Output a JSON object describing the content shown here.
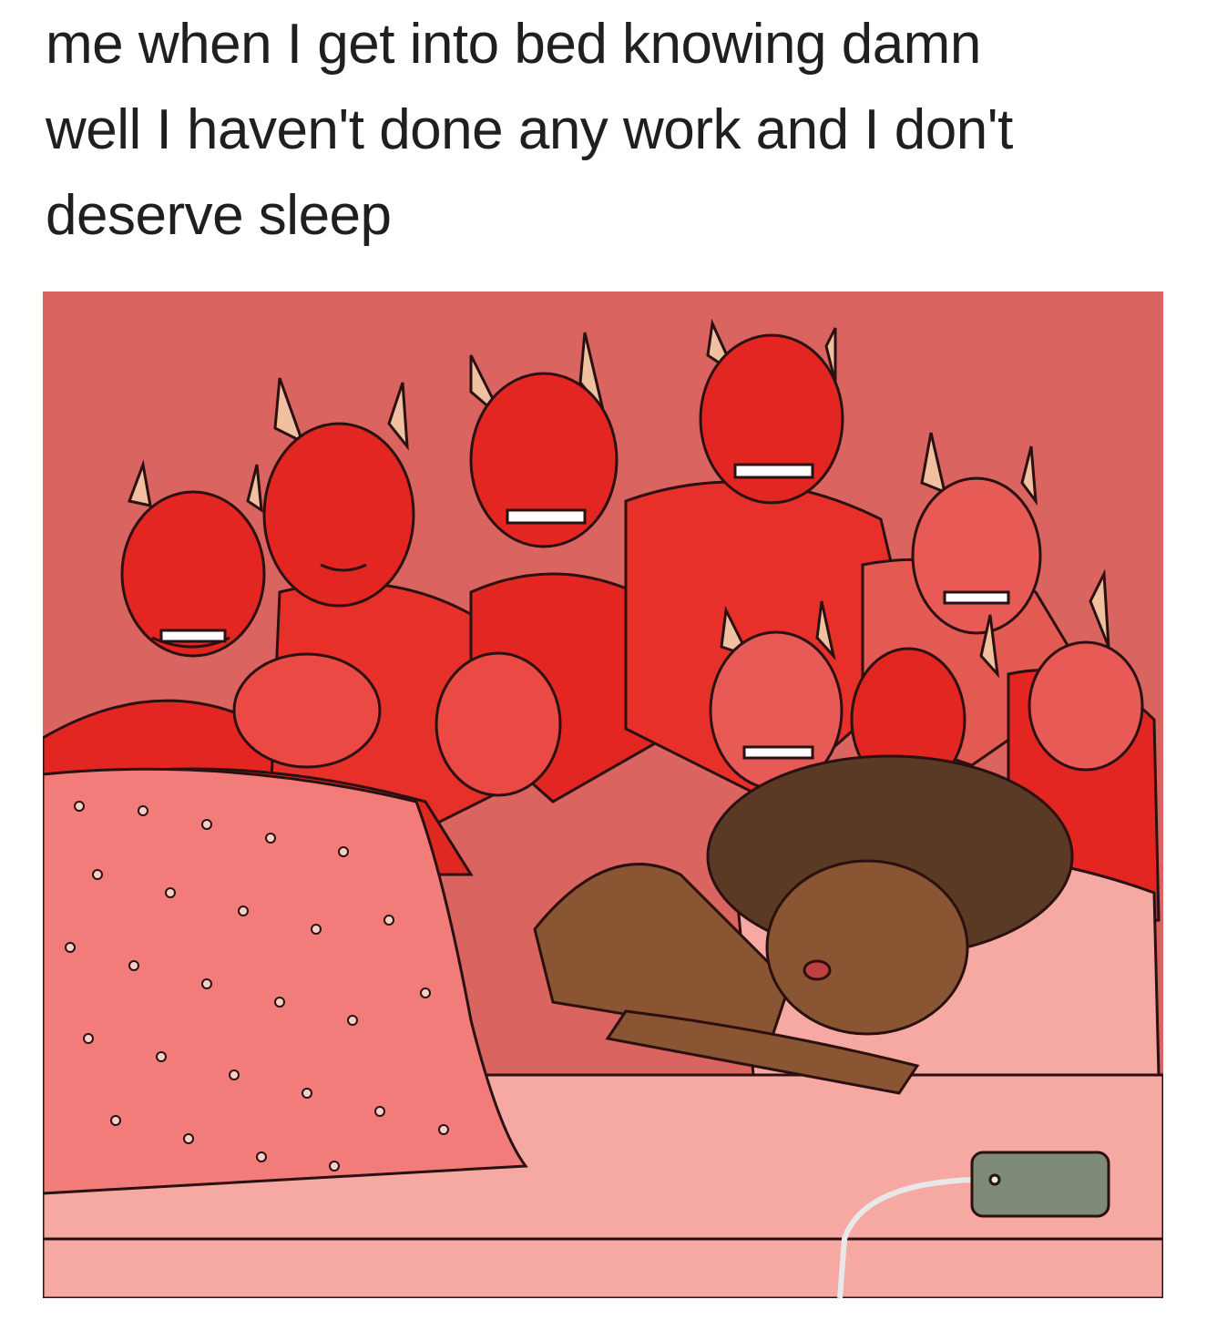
{
  "caption": {
    "line1": "me when I get into bed knowing damn",
    "line2": "well I haven't done any work and I don't",
    "line3": "deserve sleep"
  },
  "illustration": {
    "subject": "devils-surrounding-sleeping-person",
    "colors": {
      "wall": "#d96460",
      "devil": "#e32622",
      "devil_dark": "#c41b18",
      "outline": "#2a1010",
      "blanket": "#f27c79",
      "sheet": "#f6a9a3",
      "skin": "#8a5532",
      "hair": "#5a3a24",
      "phone": "#7d8a78"
    }
  }
}
